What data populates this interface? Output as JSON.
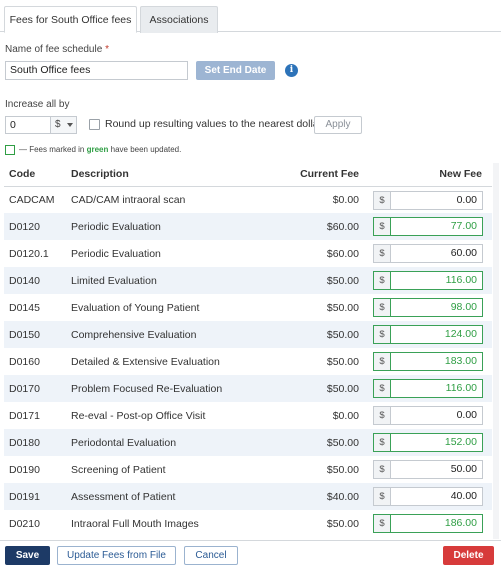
{
  "tabs": [
    {
      "label": "Fees for South Office fees",
      "active": true
    },
    {
      "label": "Associations",
      "active": false
    }
  ],
  "schedule": {
    "name_label": "Name of fee schedule",
    "required_marker": "*",
    "name_value": "South Office fees",
    "set_end_date_label": "Set End Date",
    "info_icon": "i"
  },
  "increase": {
    "label": "Increase all by",
    "value": "0",
    "unit": "$",
    "round_label": "Round up resulting values to the nearest dollar",
    "round_checked": false,
    "apply_label": "Apply"
  },
  "legend": {
    "prefix": "— Fees marked in",
    "green_word": "green",
    "suffix": "have been updated.",
    "color": "#2f9e44"
  },
  "table": {
    "headers": {
      "code": "Code",
      "description": "Description",
      "current_fee": "Current Fee",
      "new_fee": "New Fee"
    },
    "currency_prefix": "$",
    "rows": [
      {
        "code": "CADCAM",
        "description": "CAD/CAM intraoral scan",
        "current_fee": "$0.00",
        "new_fee": "0.00",
        "updated": false
      },
      {
        "code": "D0120",
        "description": "Periodic Evaluation",
        "current_fee": "$60.00",
        "new_fee": "77.00",
        "updated": true
      },
      {
        "code": "D0120.1",
        "description": "Periodic Evaluation",
        "current_fee": "$60.00",
        "new_fee": "60.00",
        "updated": false
      },
      {
        "code": "D0140",
        "description": "Limited Evaluation",
        "current_fee": "$50.00",
        "new_fee": "116.00",
        "updated": true
      },
      {
        "code": "D0145",
        "description": "Evaluation of Young Patient",
        "current_fee": "$50.00",
        "new_fee": "98.00",
        "updated": true
      },
      {
        "code": "D0150",
        "description": "Comprehensive Evaluation",
        "current_fee": "$50.00",
        "new_fee": "124.00",
        "updated": true
      },
      {
        "code": "D0160",
        "description": "Detailed & Extensive Evaluation",
        "current_fee": "$50.00",
        "new_fee": "183.00",
        "updated": true
      },
      {
        "code": "D0170",
        "description": "Problem Focused Re-Evaluation",
        "current_fee": "$50.00",
        "new_fee": "116.00",
        "updated": true
      },
      {
        "code": "D0171",
        "description": "Re-eval - Post-op Office Visit",
        "current_fee": "$0.00",
        "new_fee": "0.00",
        "updated": false
      },
      {
        "code": "D0180",
        "description": "Periodontal Evaluation",
        "current_fee": "$50.00",
        "new_fee": "152.00",
        "updated": true
      },
      {
        "code": "D0190",
        "description": "Screening of Patient",
        "current_fee": "$50.00",
        "new_fee": "50.00",
        "updated": false
      },
      {
        "code": "D0191",
        "description": "Assessment of Patient",
        "current_fee": "$40.00",
        "new_fee": "40.00",
        "updated": false
      },
      {
        "code": "D0210",
        "description": "Intraoral Full Mouth Images",
        "current_fee": "$50.00",
        "new_fee": "186.00",
        "updated": true
      }
    ]
  },
  "footer": {
    "save_label": "Save",
    "update_label": "Update Fees from File",
    "cancel_label": "Cancel",
    "delete_label": "Delete"
  },
  "colors": {
    "primary": "#1d3a66",
    "danger": "#d73b3b",
    "updated_green": "#2f9e44",
    "row_stripe": "#eef3f9"
  }
}
